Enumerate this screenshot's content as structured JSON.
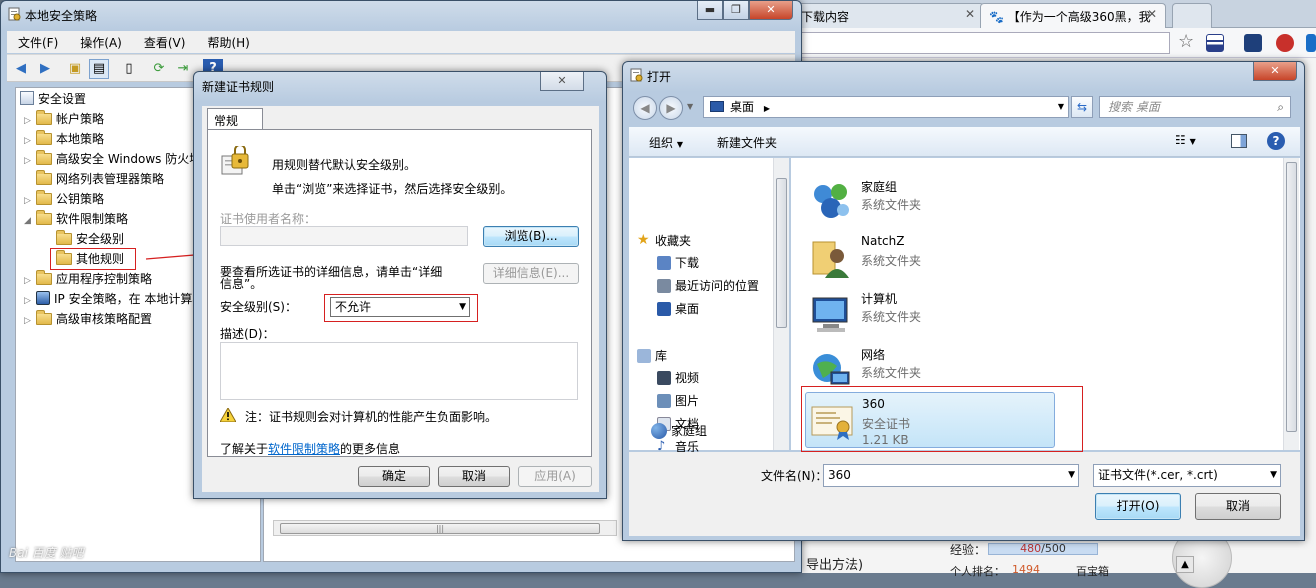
{
  "browser": {
    "tabs": [
      "下载内容",
      "【作为一个高级360黑，我"
    ],
    "bottom_text": "导出方法)",
    "exp_label": "经验：",
    "exp_value": "480",
    "exp_sep": "/",
    "exp_max": "500",
    "rank_label": "个人排名：",
    "rank_value": "1494",
    "rank_extra": "百宝箱"
  },
  "secpol": {
    "title": "本地安全策略",
    "menu": [
      "文件(F)",
      "操作(A)",
      "查看(V)",
      "帮助(H)"
    ],
    "tree": [
      {
        "label": "安全设置"
      },
      {
        "label": "帐户策略"
      },
      {
        "label": "本地策略"
      },
      {
        "label": "高级安全 Windows 防火墙"
      },
      {
        "label": "网络列表管理器策略"
      },
      {
        "label": "公钥策略"
      },
      {
        "label": "软件限制策略"
      },
      {
        "label": "安全级别"
      },
      {
        "label": "其他规则"
      },
      {
        "label": "应用程序控制策略"
      },
      {
        "label": "IP 安全策略，在 本地计算机"
      },
      {
        "label": "高级审核策略配置"
      }
    ],
    "watermark": "Bai 百度 贴吧"
  },
  "newcert": {
    "title": "新建证书规则",
    "tab": "常规",
    "desc1": "用规则替代默认安全级别。",
    "desc2": "单击“浏览”来选择证书，然后选择安全级别。",
    "subject_label": "证书使用者名称：",
    "browse_button": "浏览(B)...",
    "details_text1": "要查看所选证书的详细信息，请单击“详细",
    "details_text2": "信息”。",
    "details_button": "详细信息(E)...",
    "security_level_label": "安全级别(S)：",
    "security_level_value": "不允许",
    "description_label": "描述(D)：",
    "note": "注：证书规则会对计算机的性能产生负面影响。",
    "learn_prefix": "了解关于",
    "learn_link": "软件限制策略",
    "learn_suffix": "的更多信息",
    "ok": "确定",
    "cancel": "取消",
    "apply": "应用(A)"
  },
  "open": {
    "title": "打开",
    "path": "桌面",
    "search_placeholder": "搜索 桌面",
    "organize": "组织",
    "new_folder": "新建文件夹",
    "nav": [
      {
        "label": "收藏夹",
        "icon": "star-icon"
      },
      {
        "label": "下载",
        "icon": "downloads-icon"
      },
      {
        "label": "最近访问的位置",
        "icon": "recent-places-icon"
      },
      {
        "label": "桌面",
        "icon": "desktop-icon"
      },
      {
        "label": "库",
        "icon": "library-icon"
      },
      {
        "label": "视频",
        "icon": "video-icon"
      },
      {
        "label": "图片",
        "icon": "pictures-icon"
      },
      {
        "label": "文档",
        "icon": "documents-icon"
      },
      {
        "label": "音乐",
        "icon": "music-icon"
      },
      {
        "label": "家庭组",
        "icon": "homegroup-icon"
      }
    ],
    "files": [
      {
        "name": "家庭组",
        "type": "系统文件夹"
      },
      {
        "name": "NatchZ",
        "type": "系统文件夹"
      },
      {
        "name": "计算机",
        "type": "系统文件夹"
      },
      {
        "name": "网络",
        "type": "系统文件夹"
      },
      {
        "name": "360",
        "type": "安全证书",
        "size": "1.21 KB"
      }
    ],
    "filename_label": "文件名(N)：",
    "filename_value": "360",
    "filter_value": "证书文件(*.cer, *.crt)",
    "open_button": "打开(O)",
    "cancel_button": "取消"
  },
  "colors": {
    "highlight_red": "#d62020",
    "link_blue": "#0066cc",
    "selection": "#c4e4f8"
  }
}
